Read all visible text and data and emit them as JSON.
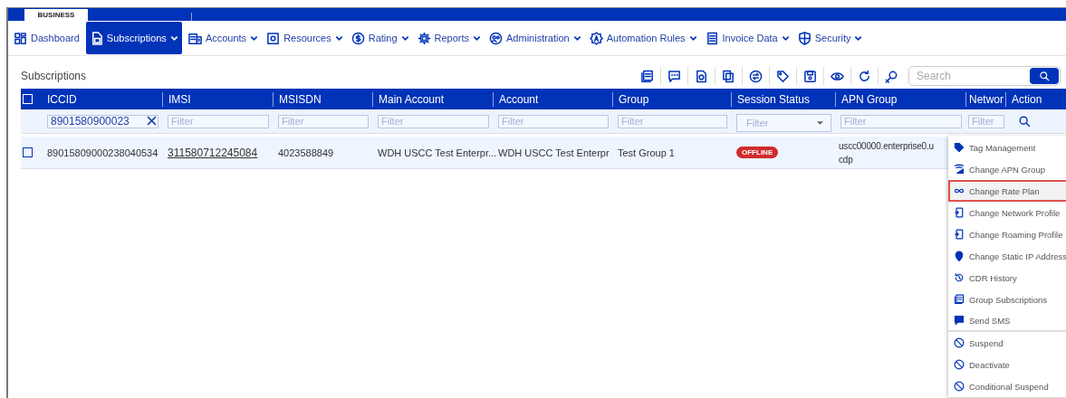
{
  "logo": {
    "text": "BUSINESS"
  },
  "nav": [
    {
      "label": "Dashboard",
      "selected": false
    },
    {
      "label": "Subscriptions",
      "selected": true
    },
    {
      "label": "Accounts",
      "selected": false
    },
    {
      "label": "Resources",
      "selected": false
    },
    {
      "label": "Rating",
      "selected": false
    },
    {
      "label": "Reports",
      "selected": false
    },
    {
      "label": "Administration",
      "selected": false
    },
    {
      "label": "Automation Rules",
      "selected": false
    },
    {
      "label": "Invoice Data",
      "selected": false
    },
    {
      "label": "Security",
      "selected": false
    }
  ],
  "panel": {
    "title": "Subscriptions",
    "search": {
      "placeholder": "Search"
    }
  },
  "table": {
    "select_all_checked": false,
    "columns": [
      {
        "label": "ICCID",
        "filter": {
          "kind": "text",
          "value": "8901580900023"
        }
      },
      {
        "label": "IMSI",
        "filter": {
          "kind": "text",
          "placeholder": "Filter"
        }
      },
      {
        "label": "MSISDN",
        "filter": {
          "kind": "text",
          "placeholder": "Filter"
        }
      },
      {
        "label": "Main Account",
        "filter": {
          "kind": "text",
          "placeholder": "Filter"
        }
      },
      {
        "label": "Account",
        "filter": {
          "kind": "text",
          "placeholder": "Filter"
        }
      },
      {
        "label": "Group",
        "filter": {
          "kind": "text",
          "placeholder": "Filter"
        }
      },
      {
        "label": "Session Status",
        "filter": {
          "kind": "select",
          "placeholder": "Filter"
        }
      },
      {
        "label": "APN Group",
        "filter": {
          "kind": "text",
          "placeholder": "Filter"
        }
      },
      {
        "label": "Networ",
        "filter": {
          "kind": "text",
          "placeholder": "Filter"
        }
      },
      {
        "label": "Action",
        "filter": {
          "kind": "search"
        }
      }
    ],
    "rows": [
      {
        "checked": false,
        "cells": [
          "89015809000238040534",
          "311580712245084",
          "4023588849",
          "WDH USCC Test Enterpr...",
          "WDH USCC Test Enterpr",
          "Test Group 1",
          "OFFLINE",
          "uscc00000.enterprise0.u cdp"
        ]
      }
    ]
  },
  "action_menu": [
    {
      "label": "Tag Management",
      "highlighted": false
    },
    {
      "label": "Change APN Group",
      "highlighted": false
    },
    {
      "label": "Change Rate Plan",
      "highlighted": true
    },
    {
      "label": "Change Network Profile",
      "highlighted": false
    },
    {
      "label": "Change Roaming Profile",
      "highlighted": false
    },
    {
      "label": "Change Static IP Address",
      "highlighted": false
    },
    {
      "label": "CDR History",
      "highlighted": false
    },
    {
      "label": "Group Subscriptions",
      "highlighted": false
    },
    {
      "label": "Send SMS",
      "highlighted": false
    },
    {
      "label": "Suspend",
      "highlighted": false
    },
    {
      "label": "Deactivate",
      "highlighted": false
    },
    {
      "label": "Conditional Suspend",
      "highlighted": false
    }
  ]
}
